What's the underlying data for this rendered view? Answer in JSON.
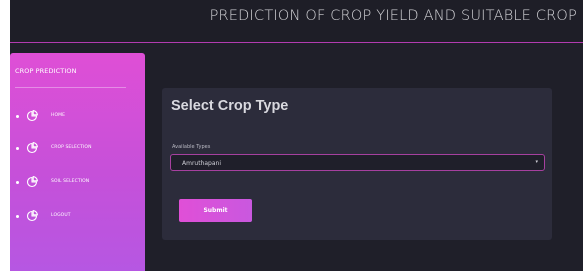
{
  "header": {
    "title": "PREDICTION OF CROP YIELD AND SUITABLE CROP"
  },
  "sidebar": {
    "title": "CROP PREDICTION",
    "items": [
      {
        "label": "HOME",
        "icon": "pie-chart-icon"
      },
      {
        "label": "CROP SELECTION",
        "icon": "pie-chart-icon"
      },
      {
        "label": "SOIL SELECTION",
        "icon": "pie-chart-icon"
      },
      {
        "label": "LOGOUT",
        "icon": "pie-chart-icon"
      }
    ]
  },
  "main": {
    "card_title": "Select Crop Type",
    "field_label": "Available Types",
    "selected_value": "Amruthapani",
    "submit_label": "Submit"
  },
  "colors": {
    "background": "#1f1f29",
    "accent": "#d64fd8",
    "card": "#2c2c3b",
    "header_border": "#b23bb0"
  }
}
